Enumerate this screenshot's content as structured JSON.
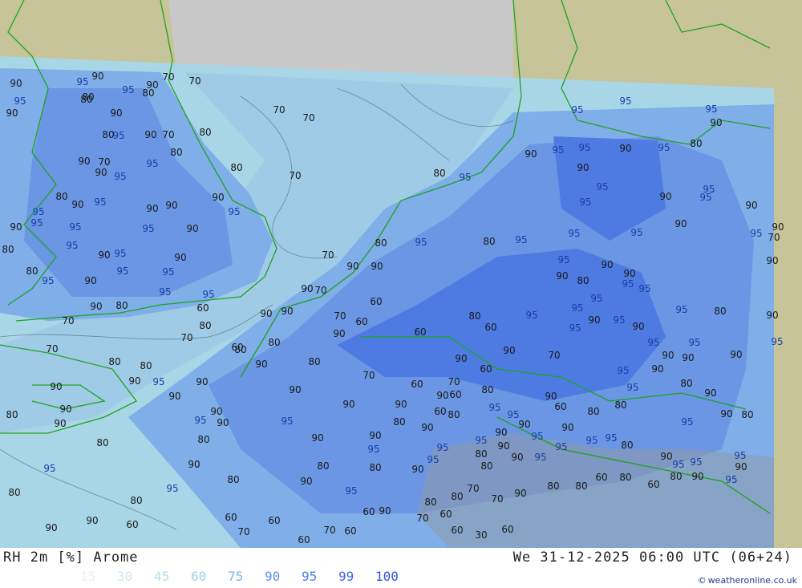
{
  "footer": {
    "title": "RH 2m [%] Arome",
    "datetime": "We 31-12-2025 06:00 UTC (06+24)",
    "credit": "weatheronline.co.uk",
    "credit_icon": "©"
  },
  "legend": [
    {
      "label": "15",
      "color": "#e6f3f9"
    },
    {
      "label": "30",
      "color": "#cfe8f2"
    },
    {
      "label": "45",
      "color": "#b6dcea"
    },
    {
      "label": "60",
      "color": "#9fd2e6"
    },
    {
      "label": "75",
      "color": "#7fb6e0"
    },
    {
      "label": "90",
      "color": "#5d93dd"
    },
    {
      "label": "95",
      "color": "#4a7ee8"
    },
    {
      "label": "99",
      "color": "#3f6ae8"
    },
    {
      "label": "100",
      "color": "#3550e0"
    }
  ],
  "colors": {
    "outside": "#c8c8c8",
    "land_outside": "#c6c498",
    "rh60": "#a8d6e6",
    "rh70": "#9fcbe6",
    "rh80": "#7faee8",
    "rh90": "#6a96e4",
    "rh95": "#4d7be2",
    "coast": "#1ea31e"
  },
  "map_labels": [
    "90",
    "95",
    "90",
    "95",
    "80",
    "95",
    "90",
    "80",
    "70",
    "70",
    "70",
    "70",
    "80",
    "70",
    "90",
    "80",
    "90",
    "95",
    "80",
    "90",
    "80",
    "70",
    "95",
    "90",
    "95",
    "90",
    "80",
    "70",
    "90",
    "95",
    "90",
    "90",
    "95",
    "90",
    "95",
    "95",
    "80",
    "95",
    "90",
    "95",
    "90",
    "80",
    "95",
    "70",
    "90",
    "95",
    "90",
    "95",
    "95",
    "80",
    "90",
    "95",
    "95",
    "90",
    "80",
    "70",
    "70",
    "80",
    "70",
    "95",
    "80",
    "90",
    "90",
    "60",
    "70",
    "90",
    "90",
    "90",
    "80",
    "95",
    "95",
    "80",
    "80",
    "95",
    "95",
    "95",
    "90",
    "95",
    "95",
    "95",
    "90",
    "80",
    "90",
    "95",
    "90",
    "95",
    "95",
    "90",
    "95",
    "95",
    "90",
    "90",
    "95",
    "90",
    "95",
    "90",
    "95",
    "95",
    "90",
    "80",
    "90",
    "90",
    "95",
    "95",
    "95",
    "95",
    "95",
    "80",
    "90",
    "95",
    "90",
    "95",
    "90",
    "95",
    "95",
    "90",
    "90",
    "90",
    "95",
    "95",
    "90",
    "95",
    "90",
    "80",
    "95",
    "90",
    "80",
    "70",
    "60",
    "90",
    "90",
    "70",
    "60",
    "80",
    "95",
    "60",
    "70",
    "60",
    "90",
    "60",
    "80",
    "90",
    "60",
    "80",
    "70",
    "60",
    "70",
    "60",
    "80",
    "90",
    "90",
    "90",
    "60",
    "80",
    "95",
    "95",
    "90",
    "60",
    "80",
    "80",
    "90",
    "95",
    "90",
    "90",
    "95",
    "90",
    "90",
    "80",
    "90",
    "90",
    "95",
    "95",
    "90",
    "90",
    "90",
    "90",
    "95",
    "90",
    "80",
    "80",
    "90",
    "90",
    "80",
    "90",
    "80",
    "95",
    "80",
    "90",
    "95",
    "80",
    "90",
    "90",
    "80",
    "80",
    "90",
    "95",
    "80",
    "95",
    "80",
    "90",
    "95",
    "95",
    "80",
    "90",
    "90",
    "95",
    "95",
    "95",
    "95",
    "80",
    "90",
    "95",
    "95",
    "95",
    "90",
    "95",
    "90",
    "80",
    "60",
    "80",
    "60",
    "80",
    "80",
    "90",
    "70",
    "70",
    "80",
    "80",
    "80",
    "70",
    "90",
    "60",
    "60",
    "70",
    "60",
    "60",
    "70",
    "60",
    "60",
    "60",
    "60",
    "30",
    "60"
  ]
}
